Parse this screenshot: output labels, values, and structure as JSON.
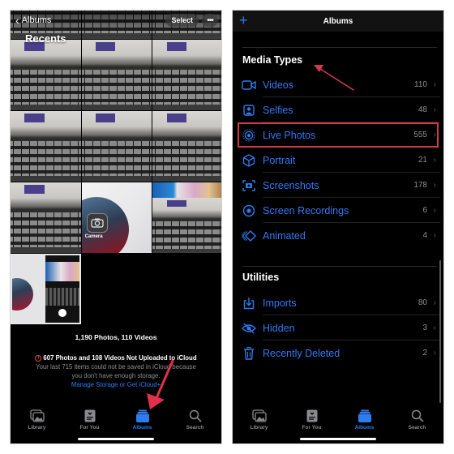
{
  "left_screen": {
    "nav": {
      "back_label": "Albums",
      "select_label": "Select",
      "more_label": "•••"
    },
    "title": "Recents",
    "summary": "1,190 Photos, 110 Videos",
    "warning": {
      "headline": "607 Photos and 108 Videos Not Uploaded to iCloud",
      "body_line1": "Your last 715 items could not be saved in iCloud because",
      "body_line2": "you don't have enough storage.",
      "link": "Manage Storage or Get iCloud+"
    },
    "camera_label": "Camera",
    "tabs": [
      {
        "label": "Library",
        "icon": "library-icon",
        "active": false
      },
      {
        "label": "For You",
        "icon": "for-you-icon",
        "active": false
      },
      {
        "label": "Albums",
        "icon": "albums-icon",
        "active": true
      },
      {
        "label": "Search",
        "icon": "search-icon",
        "active": false
      }
    ]
  },
  "right_screen": {
    "header": {
      "title": "Albums",
      "add_label": "+"
    },
    "media_types": {
      "title": "Media Types",
      "items": [
        {
          "label": "Videos",
          "count": "110",
          "icon": "video-icon"
        },
        {
          "label": "Selfies",
          "count": "48",
          "icon": "selfie-icon"
        },
        {
          "label": "Live Photos",
          "count": "555",
          "icon": "live-photo-icon",
          "highlighted": true
        },
        {
          "label": "Portrait",
          "count": "21",
          "icon": "portrait-cube-icon"
        },
        {
          "label": "Screenshots",
          "count": "178",
          "icon": "screenshot-icon"
        },
        {
          "label": "Screen Recordings",
          "count": "6",
          "icon": "screen-recording-icon"
        },
        {
          "label": "Animated",
          "count": "4",
          "icon": "animated-icon"
        }
      ]
    },
    "utilities": {
      "title": "Utilities",
      "items": [
        {
          "label": "Imports",
          "count": "80",
          "icon": "import-icon"
        },
        {
          "label": "Hidden",
          "count": "3",
          "icon": "hidden-eye-icon"
        },
        {
          "label": "Recently Deleted",
          "count": "2",
          "icon": "trash-icon"
        }
      ]
    },
    "tabs": [
      {
        "label": "Library",
        "icon": "library-icon",
        "active": false
      },
      {
        "label": "For You",
        "icon": "for-you-icon",
        "active": false
      },
      {
        "label": "Albums",
        "icon": "albums-icon",
        "active": true
      },
      {
        "label": "Search",
        "icon": "search-icon",
        "active": false
      }
    ]
  },
  "colors": {
    "accent": "#2f7bf0",
    "annotation": "#d23a48",
    "background": "#000000"
  }
}
